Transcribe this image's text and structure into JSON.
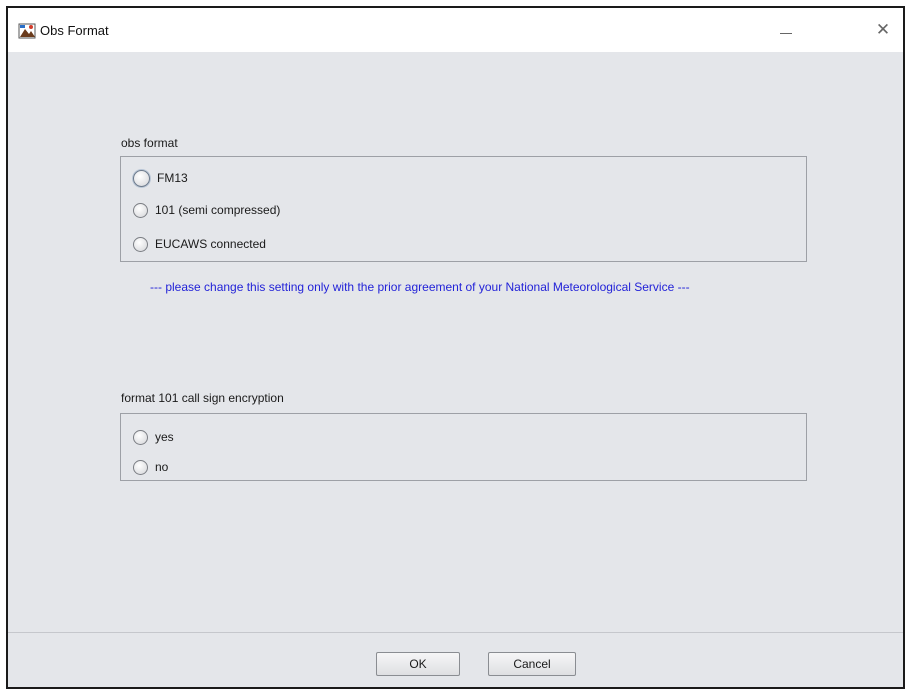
{
  "window": {
    "title": "Obs Format",
    "close_glyph": "✕"
  },
  "obs_format": {
    "label": "obs format",
    "options": [
      {
        "label": "FM13",
        "selected": false,
        "focused": true
      },
      {
        "label": "101 (semi compressed)",
        "selected": false
      },
      {
        "label": "EUCAWS connected",
        "selected": false
      }
    ],
    "note": "--- please change this setting only with the prior agreement of your National Meteorological Service ---"
  },
  "call_sign": {
    "label": "format 101 call sign encryption",
    "options": [
      {
        "label": "yes",
        "selected": false
      },
      {
        "label": "no",
        "selected": false
      }
    ]
  },
  "buttons": {
    "ok": "OK",
    "cancel": "Cancel"
  },
  "colors": {
    "background": "#e4e6ea",
    "note_text": "#2323d8",
    "group_border": "#9da0a6"
  },
  "icons": [
    "app-icon",
    "minimize-icon",
    "maximize-icon",
    "close-icon"
  ]
}
